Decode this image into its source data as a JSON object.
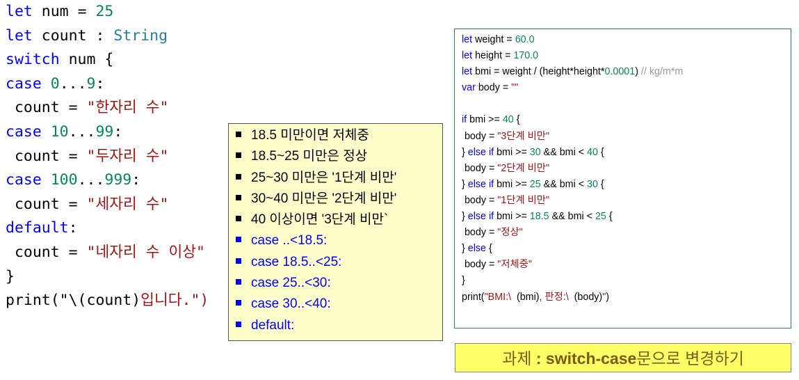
{
  "left_code": {
    "l1": {
      "kw": "let",
      "rest": " num = ",
      "num": "25"
    },
    "l2": {
      "kw": "let",
      "rest": " count : ",
      "type": "String"
    },
    "l3": {
      "kw": "switch",
      "rest": " num {"
    },
    "l4": {
      "kw": "case",
      "a": "0",
      "dots": "...",
      "b": "9",
      "colon": ":"
    },
    "l5": {
      "pre": " count = ",
      "str": "\"한자리 수\""
    },
    "l6": {
      "kw": "case",
      "a": "10",
      "dots": "...",
      "b": "99",
      "colon": ":"
    },
    "l7": {
      "pre": " count = ",
      "str": "\"두자리 수\""
    },
    "l8": {
      "kw": "case",
      "a": "100",
      "dots": "...",
      "b": "999",
      "colon": ":"
    },
    "l9": {
      "pre": " count = ",
      "str": "\"세자리 수\""
    },
    "l10": {
      "kw": "default",
      "colon": ":"
    },
    "l11": {
      "pre": " count = ",
      "str": "\"네자리 수 이상\""
    },
    "l12": {
      "text": "}"
    },
    "l13": {
      "pre": "print(\"\\(count)",
      "str": "입니다.\")"
    }
  },
  "note": {
    "items": [
      "18.5 미만이면 저체중",
      "18.5~25 미만은 정상",
      "25~30 미만은 '1단계 비만'",
      "30~40 미만은 '2단계 비만'",
      "40 이상이면 '3단계 비만`",
      "case ..<18.5:",
      "case 18.5..<25:",
      "case 25..<30:",
      "case 30..<40:",
      "default:"
    ]
  },
  "bmi_code": {
    "l1": {
      "kw": "let",
      "rest": " weight = ",
      "num": "60.0"
    },
    "l2": {
      "kw": "let",
      "rest": " height = ",
      "num": "170.0"
    },
    "l3": {
      "kw": "let",
      "rest": " bmi = weight / (height*height*",
      "num": "0.0001",
      "rest2": ") ",
      "comment": "// kg/m*m"
    },
    "l4": {
      "kw": "var",
      "rest": " body = ",
      "str": "\"\""
    },
    "l6": {
      "kw": "if",
      "rest": " bmi >= ",
      "num": "40",
      "rest2": " {"
    },
    "l7": {
      "pre": " body = ",
      "str": "\"3단계 비만\""
    },
    "l8": {
      "pre": "} ",
      "kw1": "else",
      "sp": " ",
      "kw2": "if",
      "rest": " bmi >= ",
      "num": "30",
      "rest2": " && bmi < ",
      "num2": "40",
      "rest3": " {"
    },
    "l9": {
      "pre": " body = ",
      "str": "\"2단계 비만\""
    },
    "l10": {
      "pre": "} ",
      "kw1": "else",
      "sp": " ",
      "kw2": "if",
      "rest": " bmi >= ",
      "num": "25",
      "rest2": " && bmi < ",
      "num2": "30",
      "rest3": " {"
    },
    "l11": {
      "pre": " body = ",
      "str": "\"1단계 비만\""
    },
    "l12": {
      "pre": "} ",
      "kw1": "else",
      "sp": " ",
      "kw2": "if",
      "rest": " bmi >= ",
      "num": "18.5",
      "rest2": " && bmi < ",
      "num2": "25",
      "rest3": " {"
    },
    "l13": {
      "pre": " body = ",
      "str": "\"정상\""
    },
    "l14": {
      "pre": "} ",
      "kw1": "else",
      "rest": " {"
    },
    "l15": {
      "pre": " body = ",
      "str": "\"저체중\""
    },
    "l16": {
      "text": "}"
    },
    "l17": {
      "pre": "print(",
      "str": "\"BMI:\\  ",
      "mid": "(bmi)",
      "str2": ", 판정:\\  ",
      "mid2": "(body)",
      "str3": "\"",
      "end": ")"
    }
  },
  "task": {
    "prefix": "과제 ",
    "bold": ": switch-case",
    "suffix": "문으로 변경하기"
  },
  "colors": {
    "keyword": "#0000ff",
    "number": "#098658",
    "string": "#a31515",
    "type": "#267f99",
    "note_bg": "#ffffcc",
    "banner_bg": "#ffff66"
  }
}
